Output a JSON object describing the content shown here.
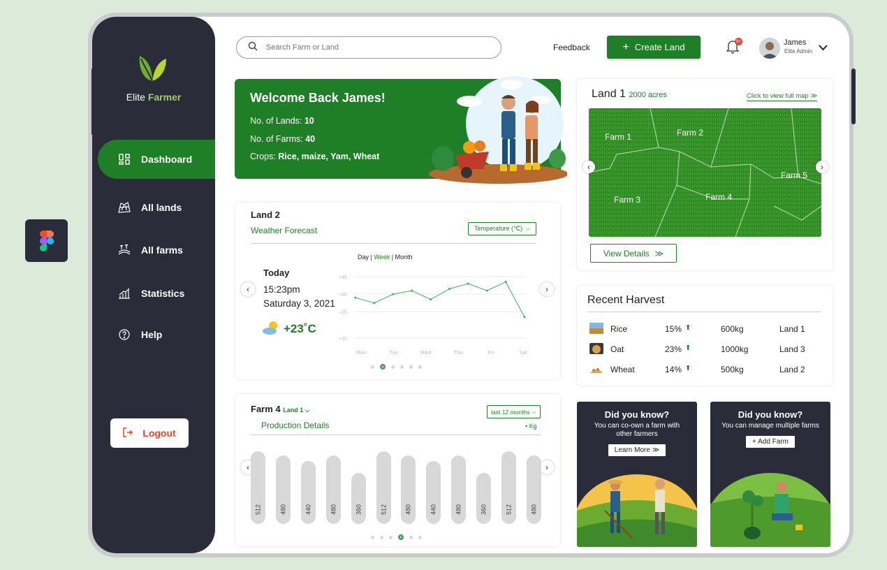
{
  "app": {
    "brand_part1": "Elite",
    "brand_part2": "Farmer",
    "accent": "#1e7f26",
    "sidebar_bg": "#2b2c3a"
  },
  "sidebar": {
    "items": [
      {
        "label": "Dashboard",
        "icon": "dashboard-icon",
        "active": true
      },
      {
        "label": "All lands",
        "icon": "land-icon",
        "active": false
      },
      {
        "label": "All farms",
        "icon": "farm-icon",
        "active": false
      },
      {
        "label": "Statistics",
        "icon": "statistics-icon",
        "active": false
      },
      {
        "label": "Help",
        "icon": "help-icon",
        "active": false
      }
    ],
    "logout": "Logout"
  },
  "header": {
    "search_placeholder": "Search Farm or Land",
    "feedback": "Feedback",
    "create_land": "Create Land",
    "notif_badge": "5+",
    "user_name": "James",
    "user_role": "Elite Admin"
  },
  "welcome": {
    "title": "Welcome Back James!",
    "lands_label": "No. of Lands:",
    "lands_value": "10",
    "farms_label": "No. of Farms:",
    "farms_value": "40",
    "crops_label": "Crops:",
    "crops_value": "Rice, maize, Yam, Wheat"
  },
  "weather": {
    "land": "Land 2",
    "subtitle": "Weather Forecast",
    "dropdown": "Temperature (℃)",
    "period_day": "Day",
    "period_week": "Week",
    "period_month": "Month",
    "today": "Today",
    "time": "15:23pm",
    "date": "Saturday 3, 2021",
    "temp": "+23˚C",
    "chart_data": {
      "type": "line",
      "x": [
        "Mon",
        "Tue",
        "Wed",
        "Thu",
        "Fri",
        "Sat"
      ],
      "y_ticks": [
        "+45",
        "+35",
        "+25",
        "+10"
      ],
      "ylim": [
        10,
        45
      ],
      "series": [
        {
          "values": [
            33,
            30,
            35,
            37,
            32,
            38,
            41,
            37,
            42,
            22
          ]
        }
      ]
    },
    "page_count": 6,
    "page_active": 1
  },
  "production": {
    "farm": "Farm 4",
    "land_select": "Land 1",
    "subtitle": "Production Details",
    "range": "last 12 months",
    "unit": "• Kg",
    "chart_data": {
      "type": "bar",
      "values": [
        512,
        480,
        440,
        480,
        360,
        512,
        480,
        440,
        480,
        360,
        512,
        480
      ]
    },
    "page_count": 6,
    "page_active": 3
  },
  "land_map": {
    "title": "Land 1",
    "acres": "2000 acres",
    "link": "Click to view full map ≫",
    "farms": [
      "Farm 1",
      "Farm 2",
      "Farm 3",
      "Farm 4",
      "Farm 5"
    ],
    "view_details": "View Details"
  },
  "harvest": {
    "title": "Recent Harvest",
    "rows": [
      {
        "crop": "Rice",
        "pct": "15%",
        "qty": "600kg",
        "land": "Land 1"
      },
      {
        "crop": "Oat",
        "pct": "23%",
        "qty": "1000kg",
        "land": "Land 3"
      },
      {
        "crop": "Wheat",
        "pct": "14%",
        "qty": "500kg",
        "land": "Land 2"
      }
    ]
  },
  "promo": [
    {
      "title": "Did you know?",
      "text": "You can co-own a farm with other farmers",
      "button": "Learn More ≫"
    },
    {
      "title": "Did you know?",
      "text": "You can manage multiple farms",
      "button": "+ Add Farm"
    }
  ]
}
